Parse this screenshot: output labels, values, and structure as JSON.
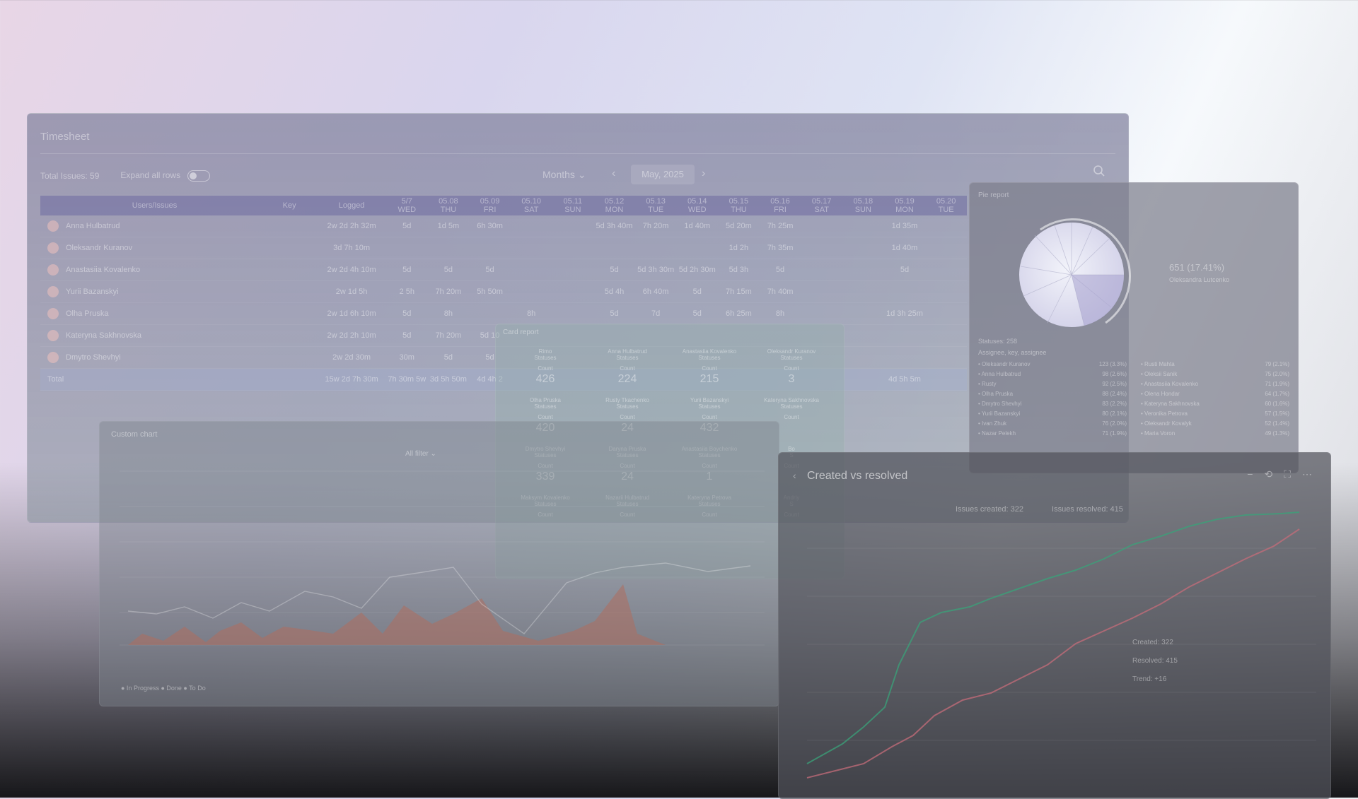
{
  "timesheet": {
    "title": "Timesheet",
    "total_issues_label": "Total Issues: 59",
    "expand_all_label": "Expand all rows",
    "view_mode": "Months",
    "period": "May, 2025",
    "columns": {
      "user": "Users/Issues",
      "key": "Key",
      "logged": "Logged",
      "days": [
        {
          "date": "5/7",
          "dow": "WED"
        },
        {
          "date": "05.08",
          "dow": "THU"
        },
        {
          "date": "05.09",
          "dow": "FRI"
        },
        {
          "date": "05.10",
          "dow": "SAT"
        },
        {
          "date": "05.11",
          "dow": "SUN"
        },
        {
          "date": "05.12",
          "dow": "MON"
        },
        {
          "date": "05.13",
          "dow": "TUE"
        },
        {
          "date": "05.14",
          "dow": "WED"
        },
        {
          "date": "05.15",
          "dow": "THU"
        },
        {
          "date": "05.16",
          "dow": "FRI"
        },
        {
          "date": "05.17",
          "dow": "SAT"
        },
        {
          "date": "05.18",
          "dow": "SUN"
        },
        {
          "date": "05.19",
          "dow": "MON"
        },
        {
          "date": "05.20",
          "dow": "TUE"
        }
      ]
    },
    "rows": [
      {
        "name": "Anna Hulbatrud",
        "logged": "2w 2d 2h 32m",
        "days": [
          "5d",
          "1d 5m",
          "6h 30m",
          "",
          "",
          "5d 3h 40m",
          "7h 20m",
          "1d 40m",
          "5d 20m",
          "7h 25m",
          "",
          "",
          "1d 35m",
          ""
        ]
      },
      {
        "name": "Oleksandr Kuranov",
        "logged": "3d 7h 10m",
        "days": [
          "",
          "",
          "",
          "",
          "",
          "",
          "",
          "",
          "1d 2h",
          "7h 35m",
          "",
          "",
          "1d 40m",
          ""
        ]
      },
      {
        "name": "Anastasiia Kovalenko",
        "logged": "2w 2d 4h 10m",
        "days": [
          "5d",
          "5d",
          "5d",
          "",
          "",
          "5d",
          "5d 3h 30m",
          "5d 2h 30m",
          "5d 3h",
          "5d",
          "",
          "",
          "5d",
          ""
        ]
      },
      {
        "name": "Yurii Bazanskyi",
        "logged": "2w 1d 5h",
        "days": [
          "2 5h",
          "7h 20m",
          "5h 50m",
          "",
          "",
          "5d 4h",
          "6h 40m",
          "5d",
          "7h 15m",
          "7h 40m",
          "",
          "",
          "",
          ""
        ]
      },
      {
        "name": "Olha Pruska",
        "logged": "2w 1d 6h 10m",
        "days": [
          "5d",
          "8h",
          "",
          "8h",
          "",
          "5d",
          "7d",
          "5d",
          "6h 25m",
          "8h",
          "",
          "",
          "1d 3h 25m",
          ""
        ]
      },
      {
        "name": "Kateryna Sakhnovska",
        "logged": "2w 2d 2h 10m",
        "days": [
          "5d",
          "7h 20m",
          "5d 10",
          "",
          "",
          "",
          "",
          "",
          "",
          "",
          "",
          "",
          "",
          ""
        ]
      },
      {
        "name": "Dmytro Shevhyi",
        "logged": "2w 2d 30m",
        "days": [
          "30m",
          "5d",
          "5d",
          "",
          "",
          "",
          "",
          "",
          "",
          "",
          "",
          "",
          "",
          ""
        ]
      }
    ],
    "total": {
      "label": "Total",
      "logged": "15w 2d 7h 30m",
      "days": [
        "7h 30m 5w",
        "3d 5h 50m",
        "4d 4h 2",
        "",
        "",
        "",
        "",
        "",
        "",
        "",
        "",
        "",
        "4d 5h 5m",
        ""
      ]
    }
  },
  "pie": {
    "title": "Pie report",
    "value": "651 (17.41%)",
    "subtitle": "Oleksandra Lutcenko",
    "meta_1": "Statuses: 258",
    "meta_2": "Assignee, key, assignee",
    "legend": [
      {
        "name": "Oleksandr Kuranov",
        "value": "123 (3.3%)"
      },
      {
        "name": "Rusti Mahta",
        "value": "79 (2.1%)"
      },
      {
        "name": "Anna Hulbatrud",
        "value": "98 (2.6%)"
      },
      {
        "name": "Oleksii Sanik",
        "value": "75 (2.0%)"
      },
      {
        "name": "Rusty",
        "value": "92 (2.5%)"
      },
      {
        "name": "Anastasiia Kovalenko",
        "value": "71 (1.9%)"
      },
      {
        "name": "Olha Pruska",
        "value": "88 (2.4%)"
      },
      {
        "name": "Olena Hondar",
        "value": "64 (1.7%)"
      },
      {
        "name": "Dmytro Shevhyi",
        "value": "83 (2.2%)"
      },
      {
        "name": "Kateryna Sakhnovska",
        "value": "60 (1.6%)"
      },
      {
        "name": "Yurii Bazanskyi",
        "value": "80 (2.1%)"
      },
      {
        "name": "Veronika Petrova",
        "value": "57 (1.5%)"
      },
      {
        "name": "Ivan Zhuk",
        "value": "76 (2.0%)"
      },
      {
        "name": "Oleksandr Kovalyk",
        "value": "52 (1.4%)"
      },
      {
        "name": "Nazar Pelekh",
        "value": "71 (1.9%)"
      },
      {
        "name": "Maria Voron",
        "value": "49 (1.3%)"
      }
    ]
  },
  "card_report": {
    "title": "Card report",
    "count_label": "Count",
    "cards": [
      {
        "name": "Rimo",
        "sub": "Statuses",
        "value": "426"
      },
      {
        "name": "Anna Hulbatrud",
        "sub": "Statuses",
        "value": "224"
      },
      {
        "name": "Anastasiia Kovalenko",
        "sub": "Statuses",
        "value": "215"
      },
      {
        "name": "Oleksandr Kuranov",
        "sub": "Statuses",
        "value": "3"
      },
      {
        "name": "Olha Pruska",
        "sub": "Statuses",
        "value": "420"
      },
      {
        "name": "Rusty Tkachenko",
        "sub": "Statuses",
        "value": "24"
      },
      {
        "name": "Yurii Bazanskyi",
        "sub": "Statuses",
        "value": "432"
      },
      {
        "name": "Kateryna Sakhnovska",
        "sub": "Statuses",
        "value": ""
      },
      {
        "name": "Dmytro Shevhyi",
        "sub": "Statuses",
        "value": "339"
      },
      {
        "name": "Daryna Pruska",
        "sub": "Statuses",
        "value": "24"
      },
      {
        "name": "Anastasiia Boychenko",
        "sub": "Statuses",
        "value": "1"
      },
      {
        "name": "Bo",
        "sub": "S",
        "value": ""
      },
      {
        "name": "Maksym Kovalenko",
        "sub": "Statuses",
        "value": ""
      },
      {
        "name": "Nazarii Hulbatrud",
        "sub": "Statuses",
        "value": ""
      },
      {
        "name": "Kateryna Petrova",
        "sub": "Statuses",
        "value": ""
      },
      {
        "name": "Andriy",
        "sub": "S",
        "value": ""
      }
    ]
  },
  "custom_chart": {
    "title": "Custom chart",
    "filter": "All filter ⌄",
    "legend": "● In Progress   ● Done   ● To Do"
  },
  "created_vs_resolved": {
    "title": "Created vs resolved",
    "back": "‹",
    "legend_created": "Issues created: 322",
    "legend_resolved": "Issues resolved: 415",
    "stats": [
      "Created: 322",
      "Resolved: 415",
      "Trend: +16"
    ],
    "colors": {
      "created": "#c56c7a",
      "resolved": "#3aa37a"
    },
    "tools": [
      "−",
      "⟲",
      "⛶",
      "⋯"
    ]
  }
}
